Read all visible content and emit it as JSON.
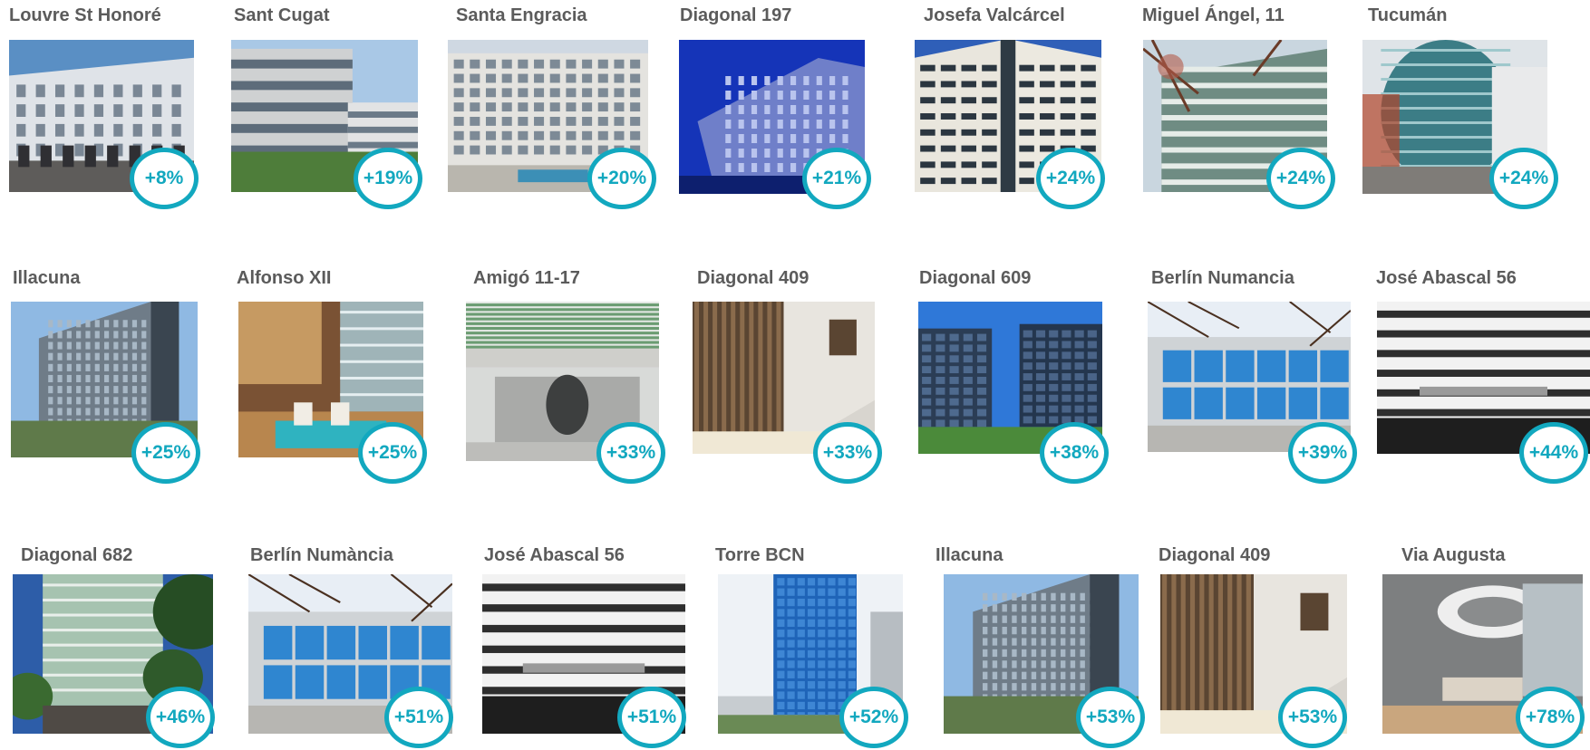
{
  "accent_color": "#12a8bf",
  "rows": [
    [
      {
        "name": "Louvre St Honoré",
        "change": "+8%",
        "photo": "classical-facade"
      },
      {
        "name": "Sant Cugat",
        "change": "+19%",
        "photo": "modern-office-lawn"
      },
      {
        "name": "Santa Engracia",
        "change": "+20%",
        "photo": "office-block-pool"
      },
      {
        "name": "Diagonal 197",
        "change": "+21%",
        "photo": "night-glass-tower"
      },
      {
        "name": "Josefa Valcárcel",
        "change": "+24%",
        "photo": "tower-upward-view"
      },
      {
        "name": "Miguel Ángel, 11",
        "change": "+24%",
        "photo": "glass-facade-branches"
      },
      {
        "name": "Tucumán",
        "change": "+24%",
        "photo": "curved-glass-office"
      }
    ],
    [
      {
        "name": "Illacuna",
        "change": "+25%",
        "photo": "tall-office-building"
      },
      {
        "name": "Alfonso XII",
        "change": "+25%",
        "photo": "lounge-interior"
      },
      {
        "name": "Amigó 11-17",
        "change": "+33%",
        "photo": "revolving-door-entrance"
      },
      {
        "name": "Diagonal 409",
        "change": "+33%",
        "photo": "wood-panel-lobby"
      },
      {
        "name": "Diagonal 609",
        "change": "+38%",
        "photo": "twin-glass-towers"
      },
      {
        "name": "Berlín Numancia",
        "change": "+39%",
        "photo": "blue-window-facade"
      },
      {
        "name": "José Abascal 56",
        "change": "+44%",
        "photo": "striped-facade"
      }
    ],
    [
      {
        "name": "Diagonal 682",
        "change": "+46%",
        "photo": "office-with-trees"
      },
      {
        "name": "Berlín Numància",
        "change": "+51%",
        "photo": "blue-window-facade"
      },
      {
        "name": "José Abascal 56",
        "change": "+51%",
        "photo": "striped-facade"
      },
      {
        "name": "Torre BCN",
        "change": "+52%",
        "photo": "blue-glass-tower"
      },
      {
        "name": "Illacuna",
        "change": "+53%",
        "photo": "tall-office-building"
      },
      {
        "name": "Diagonal 409",
        "change": "+53%",
        "photo": "wood-panel-lobby"
      },
      {
        "name": "Via Augusta",
        "change": "+78%",
        "photo": "reception-interior"
      }
    ]
  ]
}
